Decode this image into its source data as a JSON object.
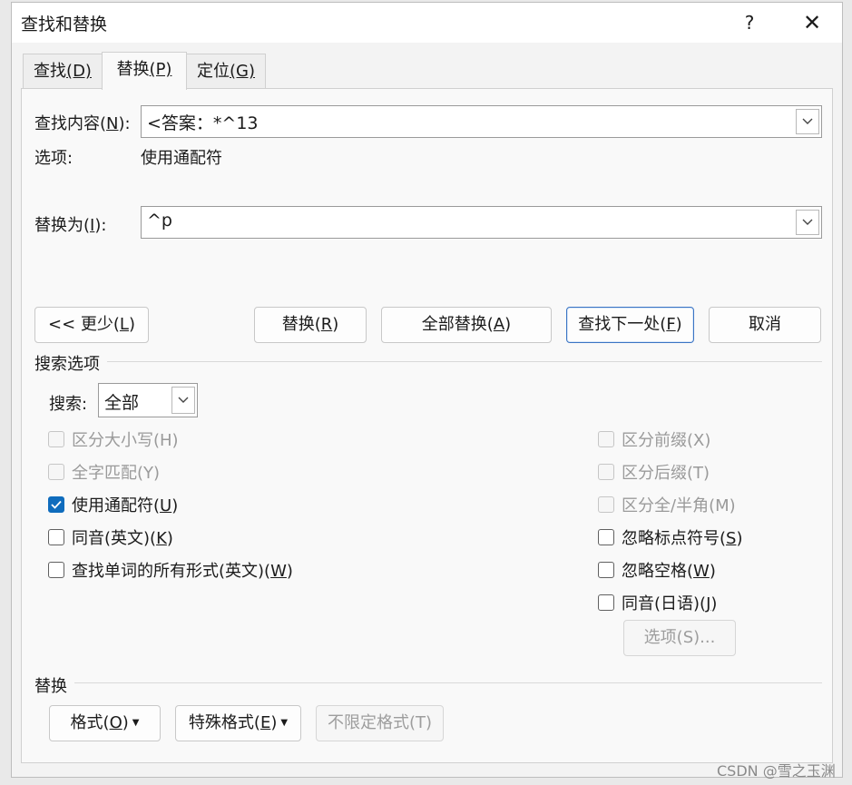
{
  "window": {
    "title": "查找和替换",
    "help_label": "?",
    "close_label": "✕"
  },
  "tabs": [
    {
      "label": "查找",
      "mnemonic": "(D)",
      "selected": false
    },
    {
      "label": "替换",
      "mnemonic": "(P)",
      "selected": true
    },
    {
      "label": "定位",
      "mnemonic": "(G)",
      "selected": false
    }
  ],
  "find": {
    "label": "查找内容(",
    "mnemonic": "N",
    "label_end": "):",
    "value": "<答案：*^13"
  },
  "options": {
    "label": "选项:",
    "value": "使用通配符"
  },
  "replace": {
    "label": "替换为(",
    "mnemonic": "I",
    "label_end": "):",
    "value": "^p"
  },
  "buttons": {
    "less": {
      "label": "<< 更少(",
      "mnemonic": "L",
      "end": ")"
    },
    "replace": {
      "label": "替换(",
      "mnemonic": "R",
      "end": ")"
    },
    "replace_all": {
      "label": "全部替换(",
      "mnemonic": "A",
      "end": ")"
    },
    "find_next": {
      "label": "查找下一处(",
      "mnemonic": "F",
      "end": ")"
    },
    "cancel": {
      "label": "取消"
    },
    "options_more": {
      "label": "选项(S)..."
    },
    "format": {
      "label": "格式(",
      "mnemonic": "O",
      "end": ")"
    },
    "special": {
      "label": "特殊格式(",
      "mnemonic": "E",
      "end": ")"
    },
    "no_format": {
      "label": "不限定格式(T)"
    }
  },
  "search_options": {
    "title": "搜索选项",
    "search_label": "搜索:",
    "search_value": "全部"
  },
  "checkboxes_left": [
    {
      "label": "区分大小写(H)",
      "checked": false,
      "disabled": true
    },
    {
      "label": "全字匹配(Y)",
      "checked": false,
      "disabled": true
    },
    {
      "label": "使用通配符(",
      "mnemonic": "U",
      "end": ")",
      "checked": true,
      "disabled": false
    },
    {
      "label": "同音(英文)(",
      "mnemonic": "K",
      "end": ")",
      "checked": false,
      "disabled": false
    },
    {
      "label": "查找单词的所有形式(英文)(",
      "mnemonic": "W",
      "end": ")",
      "checked": false,
      "disabled": false
    }
  ],
  "checkboxes_right": [
    {
      "label": "区分前缀(X)",
      "checked": false,
      "disabled": true
    },
    {
      "label": "区分后缀(T)",
      "checked": false,
      "disabled": true
    },
    {
      "label": "区分全/半角(M)",
      "checked": false,
      "disabled": true
    },
    {
      "label": "忽略标点符号(",
      "mnemonic": "S",
      "end": ")",
      "checked": false,
      "disabled": false
    },
    {
      "label": "忽略空格(",
      "mnemonic": "W",
      "end": ")",
      "checked": false,
      "disabled": false
    },
    {
      "label": "同音(日语)(",
      "mnemonic": "J",
      "end": ")",
      "checked": false,
      "disabled": false
    }
  ],
  "replace_section": {
    "title": "替换"
  },
  "watermark": "CSDN @雪之玉渊",
  "colors": {
    "accent": "#0f6cbd",
    "default_border": "#3a74c4"
  }
}
